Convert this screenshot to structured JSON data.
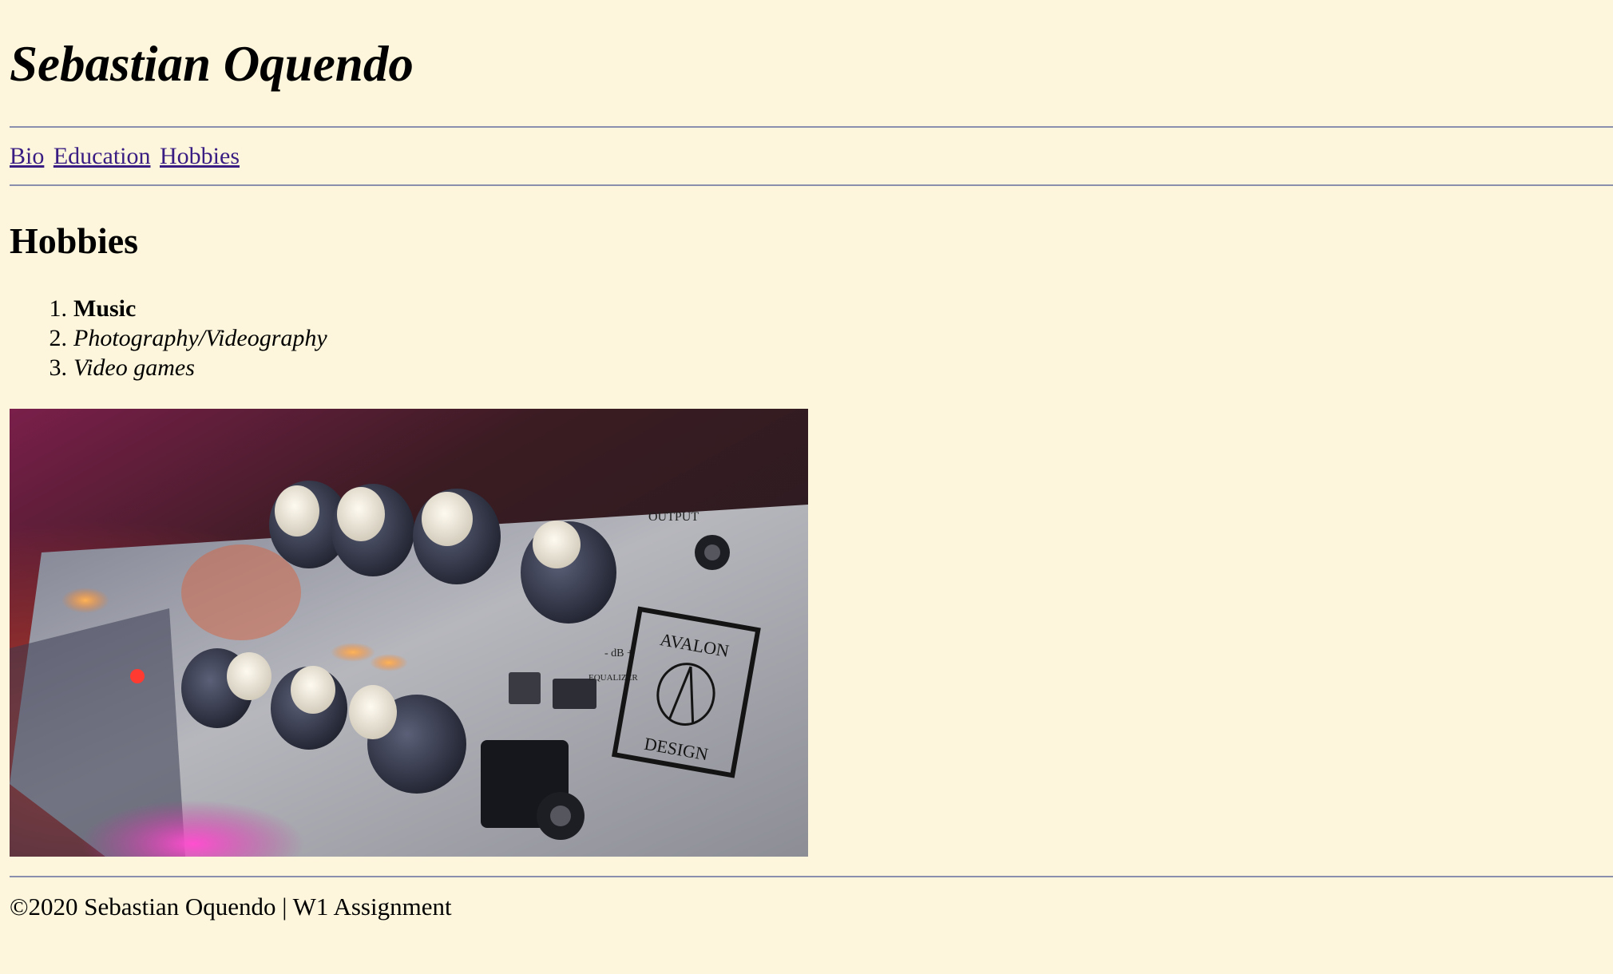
{
  "header": {
    "site_title": "Sebastian Oquendo"
  },
  "nav": {
    "links": [
      {
        "label": "Bio"
      },
      {
        "label": "Education"
      },
      {
        "label": "Hobbies"
      }
    ]
  },
  "main": {
    "section_title": "Hobbies",
    "hobbies": [
      {
        "number": "1.",
        "label": "Music"
      },
      {
        "number": "2.",
        "label": "Photography/Videography"
      },
      {
        "number": "3.",
        "label": "Video games"
      }
    ],
    "photo": {
      "panel_text": [
        "OUTPUT",
        "- dB +",
        "EQUALIZER"
      ],
      "logo_text": [
        "AVALON",
        "DESIGN"
      ]
    }
  },
  "footer": {
    "text": "©2020 Sebastian Oquendo | W1 Assignment"
  },
  "colors": {
    "page_background": "#fdf6dc",
    "link": "#3a1d82",
    "rule": "#8b8fae"
  }
}
